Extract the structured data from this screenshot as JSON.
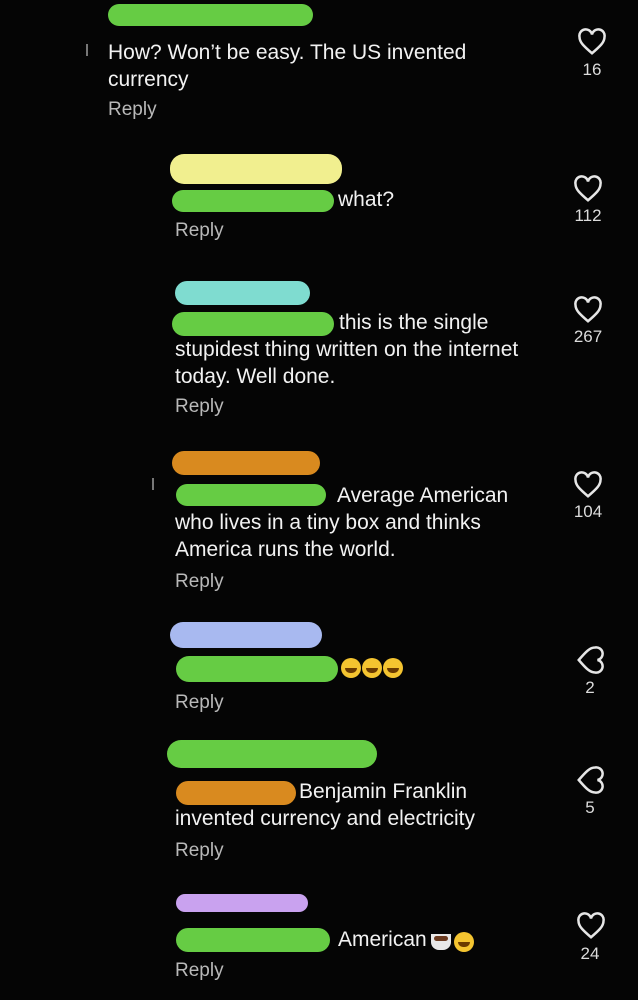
{
  "comments": [
    {
      "text": "How? Won’t be easy. The US invented currency",
      "reply": "Reply",
      "likes": "16"
    },
    {
      "text": "what?",
      "reply": "Reply",
      "likes": "112"
    },
    {
      "text": "this is the single stupidest thing written on the internet today. Well done.",
      "reply": "Reply",
      "likes": "267"
    },
    {
      "text": "Average American who lives in a tiny box and thinks America runs the world.",
      "reply": "Reply",
      "likes": "104"
    },
    {
      "text": "",
      "reply": "Reply",
      "likes": "2"
    },
    {
      "text": "Benjamin Franklin invented currency and electricity",
      "reply": "Reply",
      "likes": "5"
    },
    {
      "text": "American",
      "reply": "Reply",
      "likes": "24"
    }
  ],
  "colors": {
    "redact_green": "#66cc44",
    "redact_yellow": "#f1ef8f",
    "redact_cyan": "#7fdcd0",
    "redact_orange": "#d98a1f",
    "redact_blue": "#a8b9f0",
    "redact_purple": "#c9a2ef"
  }
}
